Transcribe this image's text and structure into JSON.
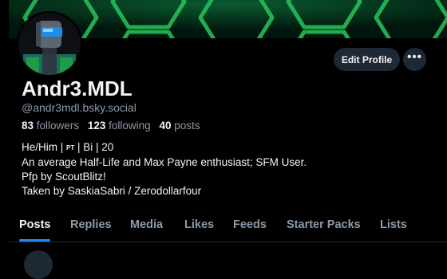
{
  "profile": {
    "display_name": "Andr3.MDL",
    "handle": "@andr3mdl.bsky.social",
    "stats": {
      "followers_count": "83",
      "followers_label": "followers",
      "following_count": "123",
      "following_label": "following",
      "posts_count": "40",
      "posts_label": "posts"
    },
    "bio": {
      "line1_start": "He/Him | ",
      "line1_badge": "PT",
      "line1_end": " | Bi | 20",
      "line2": "An average Half-Life and Max Payne enthusiast; SFM User.",
      "line3": "Pfp by ScoutBlitz!",
      "line4": "Taken by SaskiaSabri / Zerodollarfour"
    }
  },
  "actions": {
    "edit_profile": "Edit Profile",
    "more": "•••"
  },
  "tabs": [
    {
      "label": "Posts",
      "active": true
    },
    {
      "label": "Replies",
      "active": false
    },
    {
      "label": "Media",
      "active": false
    },
    {
      "label": "Likes",
      "active": false
    },
    {
      "label": "Feeds",
      "active": false
    },
    {
      "label": "Starter Packs",
      "active": false
    },
    {
      "label": "Lists",
      "active": false
    }
  ],
  "colors": {
    "background": "#000000",
    "accent": "#208bfe",
    "secondary_text": "#8a9aab",
    "button_bg": "#1e2936",
    "banner_green": "#2ee86a"
  }
}
